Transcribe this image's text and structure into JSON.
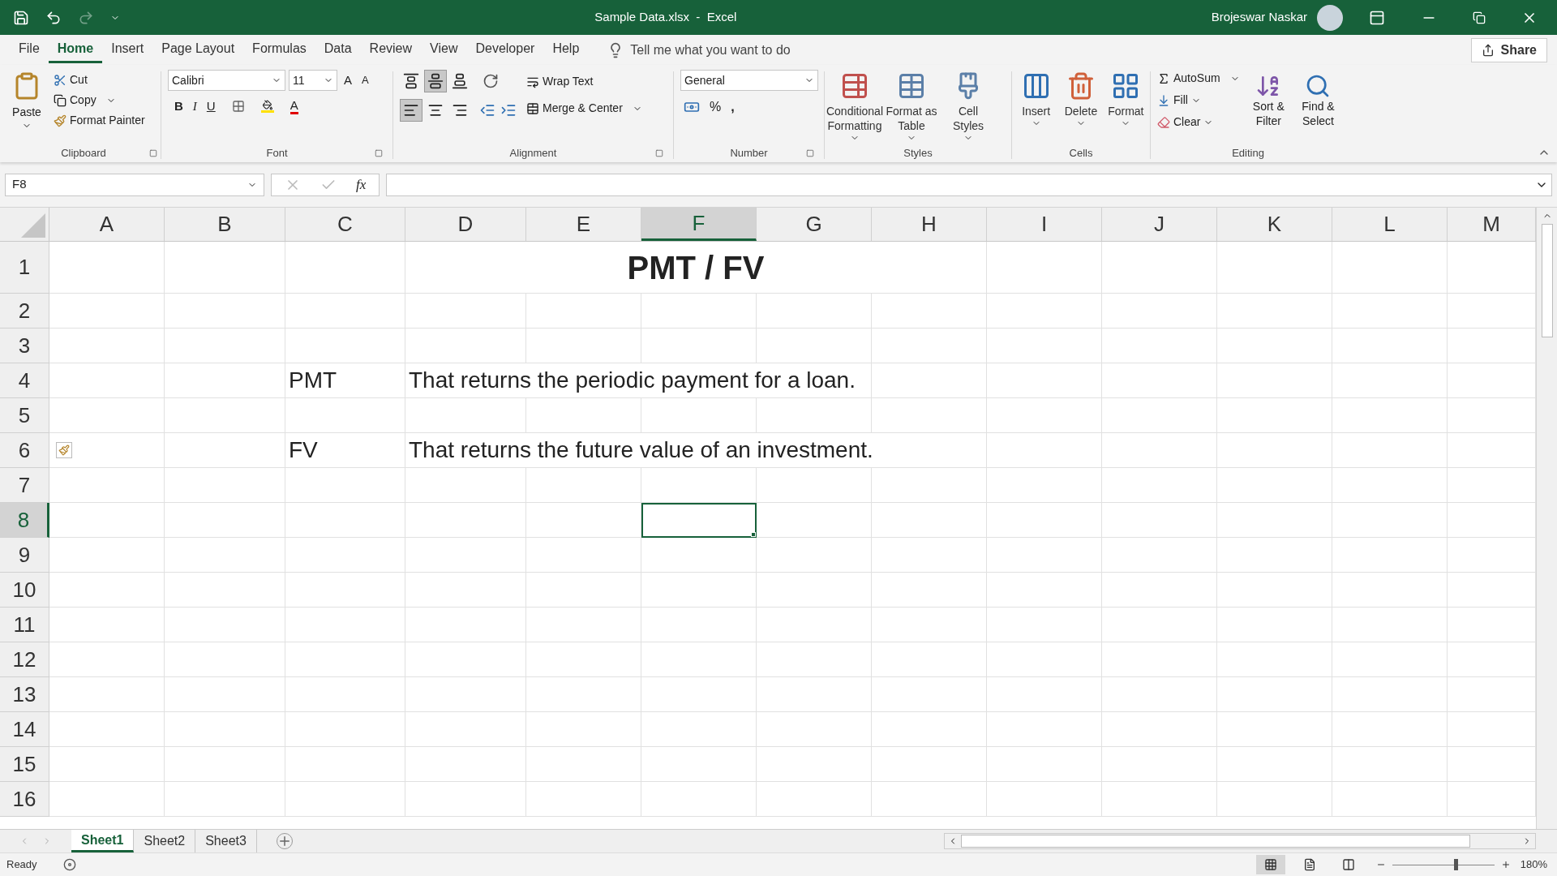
{
  "window": {
    "title": "Sample Data.xlsx  -  Excel",
    "user": "Brojeswar Naskar"
  },
  "menu_tabs": [
    {
      "label": "File",
      "selected": false
    },
    {
      "label": "Home",
      "selected": true
    },
    {
      "label": "Insert",
      "selected": false
    },
    {
      "label": "Page Layout",
      "selected": false
    },
    {
      "label": "Formulas",
      "selected": false
    },
    {
      "label": "Data",
      "selected": false
    },
    {
      "label": "Review",
      "selected": false
    },
    {
      "label": "View",
      "selected": false
    },
    {
      "label": "Developer",
      "selected": false
    },
    {
      "label": "Help",
      "selected": false
    }
  ],
  "tell_me": {
    "placeholder": "Tell me what you want to do"
  },
  "share_button": "Share",
  "ribbon": {
    "clipboard": {
      "label": "Clipboard",
      "paste": "Paste",
      "cut": "Cut",
      "copy": "Copy",
      "format_painter": "Format Painter"
    },
    "font": {
      "label": "Font",
      "font_name": "Calibri",
      "font_size": "11",
      "grow": "A",
      "shrink": "A",
      "bold": "B",
      "italic": "I",
      "underline": "U",
      "font_color": "A"
    },
    "alignment": {
      "label": "Alignment",
      "wrap_text": "Wrap Text",
      "merge_center": "Merge & Center",
      "vertical": [
        {
          "kind": "top",
          "selected": false
        },
        {
          "kind": "middle",
          "selected": true
        },
        {
          "kind": "bottom",
          "selected": false
        }
      ],
      "horizontal": [
        {
          "kind": "left",
          "selected": true
        },
        {
          "kind": "center",
          "selected": false
        },
        {
          "kind": "right",
          "selected": false
        }
      ]
    },
    "number": {
      "label": "Number",
      "format": "General",
      "percent": "%",
      "comma": ","
    },
    "styles": {
      "label": "Styles",
      "buttons": [
        {
          "kind": "conditional",
          "label": "Conditional Formatting"
        },
        {
          "kind": "table",
          "label": "Format as Table"
        },
        {
          "kind": "cell",
          "label": "Cell Styles"
        }
      ]
    },
    "cells": {
      "label": "Cells",
      "buttons": [
        {
          "kind": "insert",
          "label": "Insert"
        },
        {
          "kind": "delete",
          "label": "Delete"
        },
        {
          "kind": "format",
          "label": "Format"
        }
      ]
    },
    "editing": {
      "label": "Editing",
      "autosum": "AutoSum",
      "fill": "Fill",
      "clear": "Clear",
      "sort_filter": "Sort & Filter",
      "find_select": "Find & Select"
    }
  },
  "formula_bar": {
    "name_box": "F8",
    "fx": "fx"
  },
  "columns": [
    {
      "label": "A",
      "selected": false
    },
    {
      "label": "B",
      "selected": false
    },
    {
      "label": "C",
      "selected": false
    },
    {
      "label": "D",
      "selected": false
    },
    {
      "label": "E",
      "selected": false
    },
    {
      "label": "F",
      "selected": true
    },
    {
      "label": "G",
      "selected": false
    },
    {
      "label": "H",
      "selected": false
    },
    {
      "label": "I",
      "selected": false
    },
    {
      "label": "J",
      "selected": false
    },
    {
      "label": "K",
      "selected": false
    },
    {
      "label": "L",
      "selected": false
    },
    {
      "label": "M",
      "selected": false
    }
  ],
  "rows": [
    {
      "number": "1",
      "selected": false,
      "kind": "title",
      "title": "PMT / FV"
    },
    {
      "number": "2",
      "selected": false,
      "kind": "empty"
    },
    {
      "number": "3",
      "selected": false,
      "kind": "empty"
    },
    {
      "number": "4",
      "selected": false,
      "kind": "entry",
      "column_c": "PMT",
      "column_d": "That returns the periodic payment for a loan."
    },
    {
      "number": "5",
      "selected": false,
      "kind": "empty"
    },
    {
      "number": "6",
      "selected": false,
      "kind": "entry",
      "paste_options": true,
      "column_c": "FV",
      "column_d": "That returns the future value of an investment."
    },
    {
      "number": "7",
      "selected": false,
      "kind": "empty"
    },
    {
      "number": "8",
      "selected": true,
      "kind": "empty"
    },
    {
      "number": "9",
      "selected": false,
      "kind": "empty"
    },
    {
      "number": "10",
      "selected": false,
      "kind": "empty"
    },
    {
      "number": "11",
      "selected": false,
      "kind": "empty"
    },
    {
      "number": "12",
      "selected": false,
      "kind": "empty"
    },
    {
      "number": "13",
      "selected": false,
      "kind": "empty"
    },
    {
      "number": "14",
      "selected": false,
      "kind": "empty"
    },
    {
      "number": "15",
      "selected": false,
      "kind": "empty"
    },
    {
      "number": "16",
      "selected": false,
      "kind": "empty"
    }
  ],
  "sheets": [
    {
      "label": "Sheet1",
      "selected": true
    },
    {
      "label": "Sheet2",
      "selected": false
    },
    {
      "label": "Sheet3",
      "selected": false
    }
  ],
  "status_bar": {
    "status": "Ready",
    "views": [
      {
        "kind": "normal",
        "selected": true
      },
      {
        "kind": "page_layout",
        "selected": false
      },
      {
        "kind": "page_break",
        "selected": false
      }
    ],
    "zoom": {
      "level": 0.62,
      "reading": "180%"
    }
  }
}
